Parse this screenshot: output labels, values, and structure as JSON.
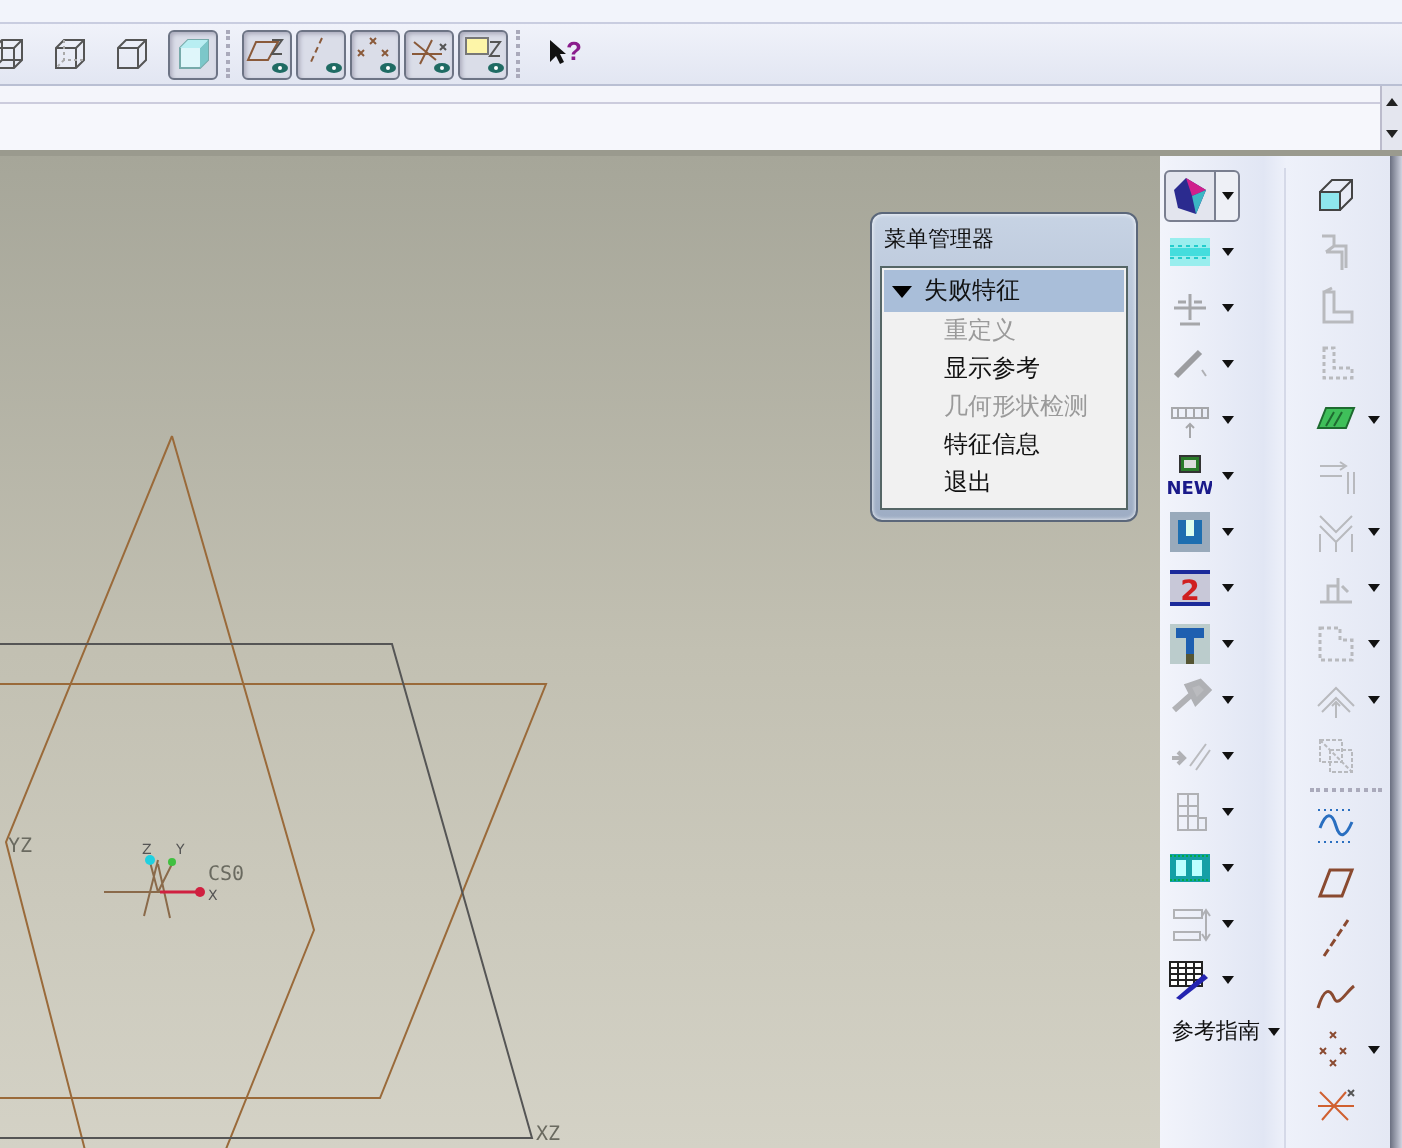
{
  "toolbar": {
    "display_style": [
      {
        "kind": "wireframe",
        "selected": false
      },
      {
        "kind": "hidden-line",
        "selected": false
      },
      {
        "kind": "no-hidden",
        "selected": false
      },
      {
        "kind": "shaded",
        "selected": true
      }
    ],
    "datum_toggles": [
      {
        "kind": "planes",
        "on": true
      },
      {
        "kind": "axes",
        "on": true
      },
      {
        "kind": "points",
        "on": true
      },
      {
        "kind": "csys",
        "on": true
      },
      {
        "kind": "annotations",
        "on": true
      }
    ],
    "help": "?"
  },
  "viewport": {
    "plane_yz": "YZ",
    "plane_xz": "XZ",
    "csys": "CS0",
    "axis_x": "X",
    "axis_y": "Y",
    "axis_z": "Z"
  },
  "menu_manager": {
    "title": "菜单管理器",
    "section": {
      "label": "失败特征",
      "expanded": true,
      "items": [
        {
          "label": "重定义",
          "disabled": true
        },
        {
          "label": "显示参考",
          "disabled": false
        },
        {
          "label": "几何形状检测",
          "disabled": true
        },
        {
          "label": "特征信息",
          "disabled": false
        },
        {
          "label": "退出",
          "disabled": false
        }
      ]
    }
  },
  "feature_toolbar": {
    "left": [
      {
        "kind": "gem",
        "selected": true,
        "disabled": false
      },
      {
        "kind": "band",
        "selected": false,
        "disabled": false
      },
      {
        "kind": "crosshair",
        "selected": false,
        "disabled": true
      },
      {
        "kind": "slash",
        "selected": false,
        "disabled": true
      },
      {
        "kind": "ruler",
        "selected": false,
        "disabled": true
      },
      {
        "kind": "new",
        "label": "NEW",
        "selected": false,
        "disabled": false
      },
      {
        "kind": "bracket",
        "selected": false,
        "disabled": false
      },
      {
        "kind": "numbered",
        "label": "2",
        "selected": false,
        "disabled": false
      },
      {
        "kind": "pin",
        "selected": false,
        "disabled": false
      },
      {
        "kind": "wrench",
        "selected": false,
        "disabled": true
      },
      {
        "kind": "pencil",
        "selected": false,
        "disabled": true
      },
      {
        "kind": "table",
        "selected": false,
        "disabled": true
      },
      {
        "kind": "film",
        "selected": false,
        "disabled": false
      },
      {
        "kind": "stack",
        "selected": false,
        "disabled": true
      },
      {
        "kind": "pen",
        "selected": false,
        "disabled": false
      }
    ],
    "guide": "参考指南",
    "right": [
      {
        "kind": "cube",
        "dropdown": false,
        "disabled": false
      },
      {
        "kind": "steps",
        "dropdown": false,
        "disabled": true
      },
      {
        "kind": "boot",
        "dropdown": false,
        "disabled": true
      },
      {
        "kind": "boot-dashed",
        "dropdown": false,
        "disabled": true
      },
      {
        "kind": "slab",
        "dropdown": true,
        "disabled": false
      },
      {
        "kind": "arrows",
        "dropdown": false,
        "disabled": true
      },
      {
        "kind": "chevrons",
        "dropdown": true,
        "disabled": true
      },
      {
        "kind": "step",
        "dropdown": true,
        "disabled": true
      },
      {
        "kind": "dashed-box",
        "dropdown": true,
        "disabled": true
      },
      {
        "kind": "dome",
        "dropdown": true,
        "disabled": true
      },
      {
        "kind": "overlap",
        "dropdown": false,
        "disabled": true
      },
      {
        "kind": "wave",
        "dropdown": false,
        "disabled": false
      },
      {
        "kind": "parallelogram",
        "dropdown": false,
        "disabled": false
      },
      {
        "kind": "dashed-line",
        "dropdown": false,
        "disabled": false
      },
      {
        "kind": "curve",
        "dropdown": false,
        "disabled": false
      },
      {
        "kind": "crosses",
        "dropdown": true,
        "disabled": false
      },
      {
        "kind": "star-cross",
        "dropdown": false,
        "disabled": false
      }
    ]
  }
}
